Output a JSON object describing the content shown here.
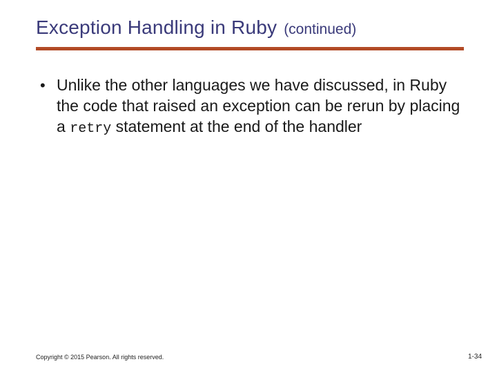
{
  "title": {
    "main": "Exception Handling in Ruby",
    "continued": "(continued)"
  },
  "bullet": {
    "text_before_code": "Unlike the other languages we have discussed, in Ruby the code that raised an exception can be rerun by placing a ",
    "code": "retry",
    "text_after_code": " statement at the end of the handler"
  },
  "footer": {
    "copyright": "Copyright © 2015 Pearson. All rights reserved.",
    "page": "1-34"
  },
  "colors": {
    "title": "#3a3a7a",
    "rule": "#b24a26",
    "body": "#1a1a1a"
  }
}
